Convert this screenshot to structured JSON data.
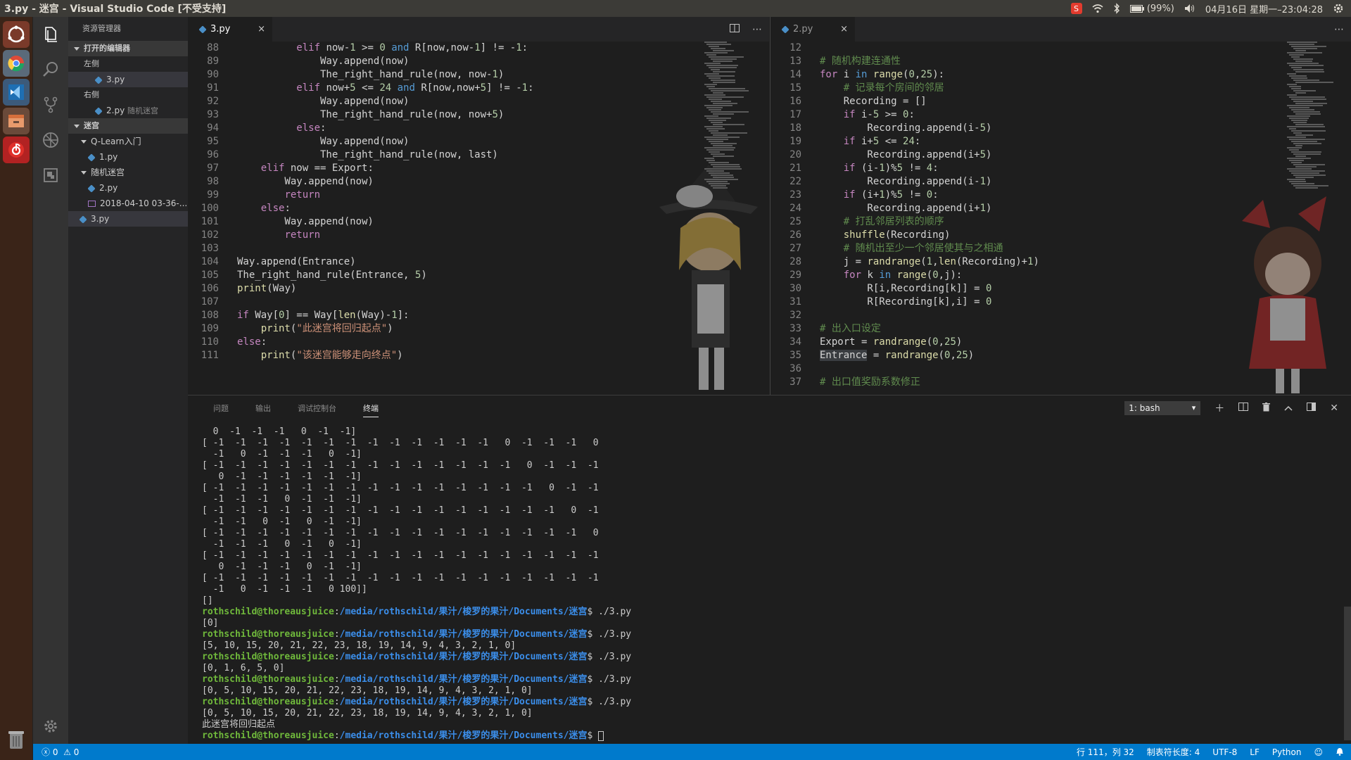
{
  "window": {
    "title": "3.py - 迷宫 - Visual Studio Code [不受支持]"
  },
  "tray": {
    "battery": "(99%)",
    "datetime": "04月16日 星期一–23:04:28"
  },
  "sidebar": {
    "header": "资源管理器",
    "open_editors": "打开的编辑器",
    "left_group": "左侧",
    "left_file": "3.py",
    "right_group": "右侧",
    "right_file": "2.py",
    "right_file_hint": "随机迷宫",
    "workspace": "迷宫",
    "folder1": "Q-Learn入门",
    "folder1_file": "1.py",
    "folder2": "随机迷宫",
    "folder2_file1": "2.py",
    "folder2_file2": "2018-04-10 03-36-...",
    "root_file": "3.py"
  },
  "editor_left": {
    "tab": "3.py",
    "close": "×",
    "lines": [
      {
        "n": "88",
        "code": "          elif now-1 >= 0 and R[now,now-1] != -1:"
      },
      {
        "n": "89",
        "code": "              Way.append(now)"
      },
      {
        "n": "90",
        "code": "              The_right_hand_rule(now, now-1)"
      },
      {
        "n": "91",
        "code": "          elif now+5 <= 24 and R[now,now+5] != -1:"
      },
      {
        "n": "92",
        "code": "              Way.append(now)"
      },
      {
        "n": "93",
        "code": "              The_right_hand_rule(now, now+5)"
      },
      {
        "n": "94",
        "code": "          else:"
      },
      {
        "n": "95",
        "code": "              Way.append(now)"
      },
      {
        "n": "96",
        "code": "              The_right_hand_rule(now, last)"
      },
      {
        "n": "97",
        "code": "    elif now == Export:"
      },
      {
        "n": "98",
        "code": "        Way.append(now)"
      },
      {
        "n": "99",
        "code": "        return"
      },
      {
        "n": "100",
        "code": "    else:"
      },
      {
        "n": "101",
        "code": "        Way.append(now)"
      },
      {
        "n": "102",
        "code": "        return"
      },
      {
        "n": "103",
        "code": ""
      },
      {
        "n": "104",
        "code": "Way.append(Entrance)"
      },
      {
        "n": "105",
        "code": "The_right_hand_rule(Entrance, 5)"
      },
      {
        "n": "106",
        "code": "print(Way)"
      },
      {
        "n": "107",
        "code": ""
      },
      {
        "n": "108",
        "code": "if Way[0] == Way[len(Way)-1]:"
      },
      {
        "n": "109",
        "code": "    print(\"此迷宫将回归起点\")"
      },
      {
        "n": "110",
        "code": "else:"
      },
      {
        "n": "111",
        "code": "    print(\"该迷宫能够走向终点\")"
      }
    ]
  },
  "editor_right": {
    "tab": "2.py",
    "close": "×",
    "lines": [
      {
        "n": "12",
        "code": ""
      },
      {
        "n": "13",
        "code": "# 随机构建连通性"
      },
      {
        "n": "14",
        "code": "for i in range(0,25):"
      },
      {
        "n": "15",
        "code": "    # 记录每个房间的邻居"
      },
      {
        "n": "16",
        "code": "    Recording = []"
      },
      {
        "n": "17",
        "code": "    if i-5 >= 0:"
      },
      {
        "n": "18",
        "code": "        Recording.append(i-5)"
      },
      {
        "n": "19",
        "code": "    if i+5 <= 24:"
      },
      {
        "n": "20",
        "code": "        Recording.append(i+5)"
      },
      {
        "n": "21",
        "code": "    if (i-1)%5 != 4:"
      },
      {
        "n": "22",
        "code": "        Recording.append(i-1)"
      },
      {
        "n": "23",
        "code": "    if (i+1)%5 != 0:"
      },
      {
        "n": "24",
        "code": "        Recording.append(i+1)"
      },
      {
        "n": "25",
        "code": "    # 打乱邻居列表的顺序"
      },
      {
        "n": "26",
        "code": "    shuffle(Recording)"
      },
      {
        "n": "27",
        "code": "    # 随机出至少一个邻居使其与之相通"
      },
      {
        "n": "28",
        "code": "    j = randrange(1,len(Recording)+1)"
      },
      {
        "n": "29",
        "code": "    for k in range(0,j):"
      },
      {
        "n": "30",
        "code": "        R[i,Recording[k]] = 0"
      },
      {
        "n": "31",
        "code": "        R[Recording[k],i] = 0"
      },
      {
        "n": "32",
        "code": ""
      },
      {
        "n": "33",
        "code": "# 出入口设定"
      },
      {
        "n": "34",
        "code": "Export = randrange(0,25)"
      },
      {
        "n": "35",
        "code": "Entrance = randrange(0,25)"
      },
      {
        "n": "36",
        "code": ""
      },
      {
        "n": "37",
        "code": "# 出口值奖励系数修正"
      }
    ]
  },
  "panel": {
    "tabs": [
      "问题",
      "输出",
      "调试控制台",
      "终端"
    ],
    "active_tab": "终端",
    "terminal_select": "1: bash",
    "prompt_user": "rothschild@thoreausjuice",
    "prompt_path": "/media/rothschild/果汁/梭罗的果汁/Documents/迷宫",
    "matrix_lines": [
      "  0  -1  -1  -1   0  -1  -1]",
      "[ -1  -1  -1  -1  -1  -1  -1  -1  -1  -1  -1  -1  -1   0  -1  -1  -1   0",
      "  -1   0  -1  -1  -1   0  -1]",
      "[ -1  -1  -1  -1  -1  -1  -1  -1  -1  -1  -1  -1  -1  -1   0  -1  -1  -1",
      "   0  -1  -1  -1  -1  -1  -1]",
      "[ -1  -1  -1  -1  -1  -1  -1  -1  -1  -1  -1  -1  -1  -1  -1   0  -1  -1",
      "  -1  -1  -1   0  -1  -1  -1]",
      "[ -1  -1  -1  -1  -1  -1  -1  -1  -1  -1  -1  -1  -1  -1  -1  -1   0  -1",
      "  -1  -1   0  -1   0  -1  -1]",
      "[ -1  -1  -1  -1  -1  -1  -1  -1  -1  -1  -1  -1  -1  -1  -1  -1  -1   0",
      "  -1  -1  -1   0  -1   0  -1]",
      "[ -1  -1  -1  -1  -1  -1  -1  -1  -1  -1  -1  -1  -1  -1  -1  -1  -1  -1",
      "   0  -1  -1  -1   0  -1  -1]",
      "[ -1  -1  -1  -1  -1  -1  -1  -1  -1  -1  -1  -1  -1  -1  -1  -1  -1  -1",
      "  -1   0  -1  -1  -1   0 100]]",
      "[]"
    ],
    "runs": [
      {
        "cmd": "./3.py",
        "out": "[0]"
      },
      {
        "cmd": "./3.py",
        "out": "[5, 10, 15, 20, 21, 22, 23, 18, 19, 14, 9, 4, 3, 2, 1, 0]"
      },
      {
        "cmd": "./3.py",
        "out": "[0, 1, 6, 5, 0]"
      },
      {
        "cmd": "./3.py",
        "out": "[0, 5, 10, 15, 20, 21, 22, 23, 18, 19, 14, 9, 4, 3, 2, 1, 0]"
      },
      {
        "cmd": "./3.py",
        "out": "[0, 5, 10, 15, 20, 21, 22, 23, 18, 19, 14, 9, 4, 3, 2, 1, 0]\n此迷宫将回归起点"
      }
    ]
  },
  "status": {
    "errors": "0",
    "warnings": "0",
    "position": "行 111，列 32",
    "tab_size": "制表符长度: 4",
    "encoding": "UTF-8",
    "eol": "LF",
    "language": "Python"
  },
  "colors": {
    "accent": "#007acc",
    "prompt_user": "#6fb83b",
    "prompt_path": "#3b8eea"
  }
}
